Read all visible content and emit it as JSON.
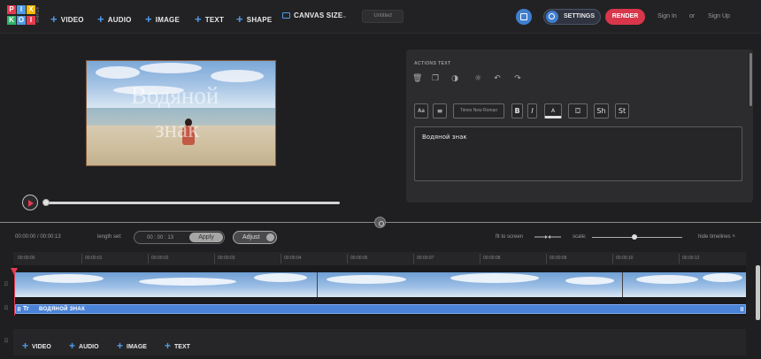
{
  "logo": {
    "letters": [
      "P",
      "I",
      "X",
      "K",
      "O",
      "I"
    ],
    "colors": [
      "#e63a4e",
      "#4e9be6",
      "#f5b800",
      "#2fb36a",
      "#4e9be6",
      "#e63a4e"
    ],
    "studio": "STUDIO"
  },
  "toolbar": {
    "video": "VIDEO",
    "audio": "AUDIO",
    "image": "IMAGE",
    "text": "TEXT",
    "shape": "SHAPE",
    "canvas_size": "CANVAS SIZE",
    "project_title": "Untitled",
    "settings": "SETTINGS",
    "render": "RENDER",
    "sign_in": "Sign In",
    "or": "or",
    "sign_up": "Sign Up"
  },
  "preview": {
    "watermark_line1": "Водяной",
    "watermark_line2": "знак"
  },
  "panel": {
    "title": "ACTIONS TEXT",
    "font_size_btn": "Aa",
    "font_name": "Times New Roman",
    "bold": "B",
    "italic": "I",
    "color_btn": "A",
    "shadow": "Sh",
    "stroke": "St",
    "text_value": "Водяной знак"
  },
  "timeline": {
    "time": "00:00:00 / 00:00:13",
    "length_label": "length set:",
    "length_value": "00 : 00 : 13",
    "apply": "Apply",
    "adjust": "Adjust",
    "fit_to_screen": "fit to screen",
    "scale": "scale:",
    "hide_timelines": "hide timelines ˄",
    "scale_level": 0.47,
    "ticks": [
      "00:00:00",
      "00:00:01",
      "00:00:02",
      "00:00:03",
      "00:00:04",
      "00:00:05",
      "00:00:07",
      "00:00:08",
      "00:00:09",
      "00:00:10",
      "00:00:12"
    ],
    "track_numbers": [
      "01",
      "02",
      "03"
    ],
    "text_track_label": "ВОДЯНОЙ ЗНАК",
    "text_track_icon": "Tr"
  },
  "add_bar": {
    "video": "VIDEO",
    "audio": "AUDIO",
    "image": "IMAGE",
    "text": "TEXT"
  },
  "accent": {
    "blue": "#4e9be6",
    "red": "#e63a4e",
    "track": "#4a83d8"
  }
}
